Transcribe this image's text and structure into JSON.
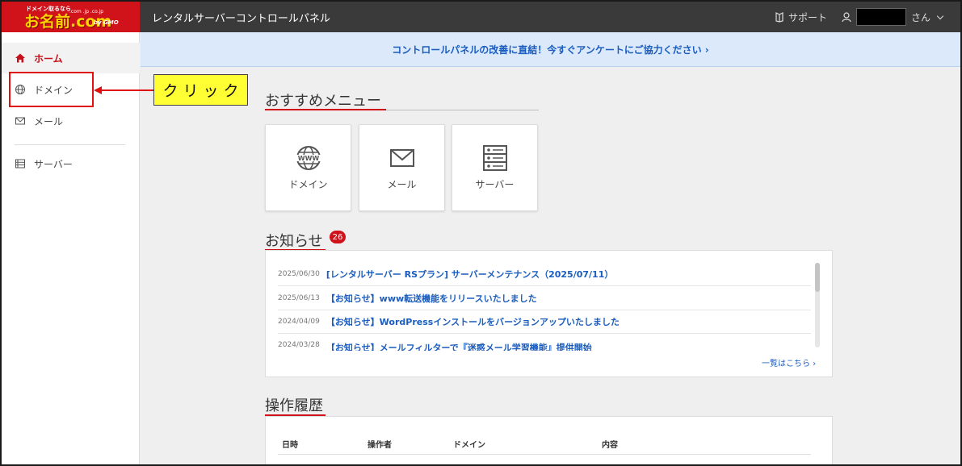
{
  "brand": {
    "tagline": "ドメイン取るなら",
    "logo_text": "お名前.com",
    "logo_tlds": ".com .jp .co.jp",
    "logo_company": "by GMO"
  },
  "header": {
    "app_title": "レンタルサーバーコントロールパネル",
    "support_label": "サポート",
    "user_suffix": "さん"
  },
  "sidebar": {
    "items": [
      {
        "label": "ホーム",
        "icon": "home-icon",
        "active": true
      },
      {
        "label": "ドメイン",
        "icon": "globe-icon",
        "active": false
      },
      {
        "label": "メール",
        "icon": "mail-icon",
        "active": false
      },
      {
        "label": "サーバー",
        "icon": "server-icon",
        "active": false
      }
    ]
  },
  "annotation": {
    "label": "クリック"
  },
  "banner": {
    "text": "コントロールパネルの改善に直結！今すぐアンケートにご協力ください ›"
  },
  "recommended": {
    "title": "おすすめメニュー",
    "tiles": [
      {
        "label": "ドメイン",
        "icon": "www-globe-icon"
      },
      {
        "label": "メール",
        "icon": "envelope-icon"
      },
      {
        "label": "サーバー",
        "icon": "server-rack-icon"
      }
    ]
  },
  "news": {
    "title": "お知らせ",
    "badge_count": "26",
    "items": [
      {
        "date": "2025/06/30",
        "title": "[レンタルサーバー RSプラン] サーバーメンテナンス（2025/07/11）"
      },
      {
        "date": "2025/06/13",
        "title": "【お知らせ】www転送機能をリリースいたしました"
      },
      {
        "date": "2024/04/09",
        "title": "【お知らせ】WordPressインストールをバージョンアップいたしました"
      },
      {
        "date": "2024/03/28",
        "title": "【お知らせ】メールフィルターで『迷惑メール学習機能』提供開始"
      }
    ],
    "more_label": "一覧はこちら ›"
  },
  "history": {
    "title": "操作履歴",
    "columns": [
      "日時",
      "操作者",
      "ドメイン",
      "内容"
    ]
  },
  "colors": {
    "brand_red": "#d0121b",
    "link_blue": "#1a5dbf",
    "header_bg": "#3a3a3a",
    "banner_bg": "#dbe9fb",
    "annotation_yellow": "#ffff33"
  }
}
